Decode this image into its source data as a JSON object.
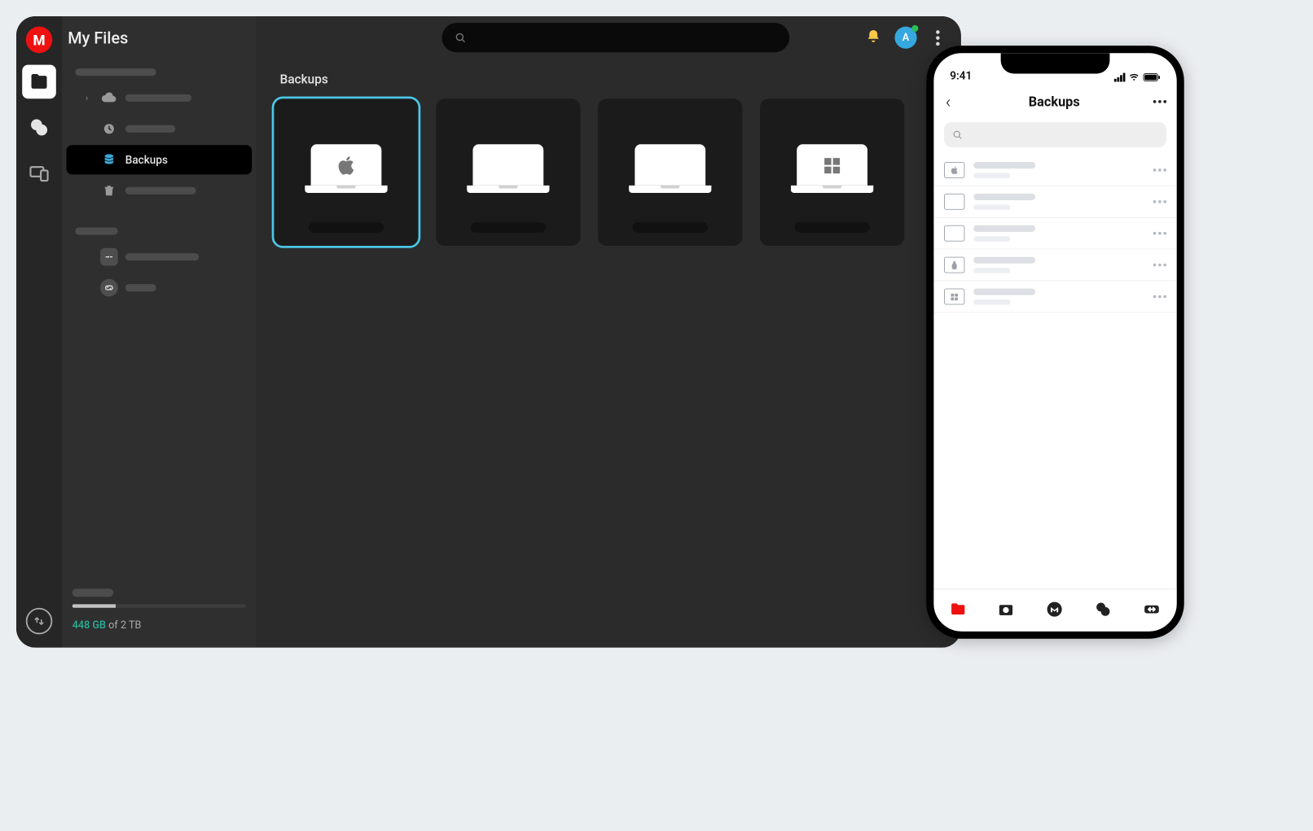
{
  "desktop": {
    "title": "My Files",
    "section_title": "Backups",
    "avatar_letter": "A",
    "sidebar": {
      "backups_label": "Backups"
    },
    "storage": {
      "used": "448 GB",
      "of_total": " of 2 TB"
    }
  },
  "phone": {
    "time": "9:41",
    "title": "Backups"
  }
}
